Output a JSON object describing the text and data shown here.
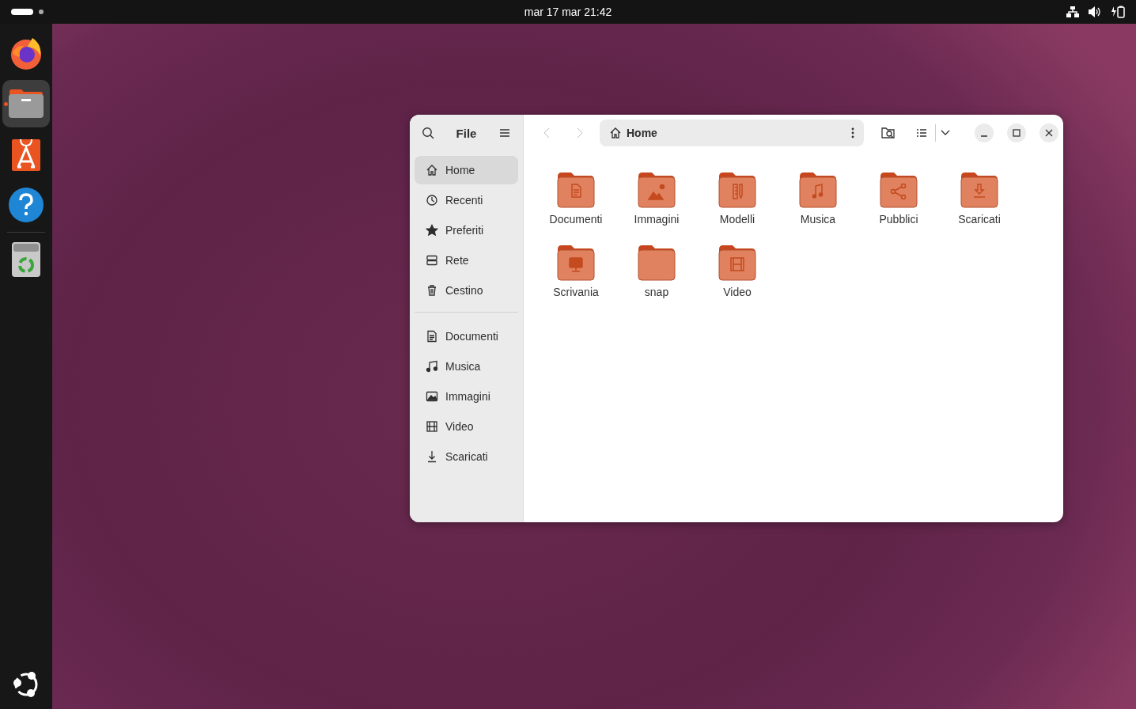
{
  "top_bar": {
    "clock": "mar 17 mar  21:42"
  },
  "dock": [
    {
      "kind": "firefox",
      "running": false,
      "selected": false
    },
    {
      "kind": "files",
      "running": true,
      "selected": true
    },
    {
      "kind": "store",
      "running": false,
      "selected": false
    },
    {
      "kind": "help",
      "running": false,
      "selected": false
    },
    {
      "kind": "trash",
      "running": false,
      "selected": false
    }
  ],
  "window": {
    "title": "File",
    "path": "Home",
    "sidebar": {
      "places": [
        {
          "label": "Home",
          "kind": "home",
          "selected": true
        },
        {
          "label": "Recenti",
          "kind": "recent",
          "selected": false
        },
        {
          "label": "Preferiti",
          "kind": "star",
          "selected": false
        },
        {
          "label": "Rete",
          "kind": "network",
          "selected": false
        },
        {
          "label": "Cestino",
          "kind": "trash",
          "selected": false
        }
      ],
      "bookmarks": [
        {
          "label": "Documenti",
          "kind": "document",
          "selected": false
        },
        {
          "label": "Musica",
          "kind": "music",
          "selected": false
        },
        {
          "label": "Immagini",
          "kind": "image",
          "selected": false
        },
        {
          "label": "Video",
          "kind": "video",
          "selected": false
        },
        {
          "label": "Scaricati",
          "kind": "download",
          "selected": false
        }
      ]
    },
    "folders": [
      {
        "name": "Documenti",
        "kind": "document"
      },
      {
        "name": "Immagini",
        "kind": "image"
      },
      {
        "name": "Modelli",
        "kind": "template"
      },
      {
        "name": "Musica",
        "kind": "music"
      },
      {
        "name": "Pubblici",
        "kind": "share"
      },
      {
        "name": "Scaricati",
        "kind": "download"
      },
      {
        "name": "Scrivania",
        "kind": "desktop"
      },
      {
        "name": "snap",
        "kind": "plain"
      },
      {
        "name": "Video",
        "kind": "video"
      }
    ]
  }
}
